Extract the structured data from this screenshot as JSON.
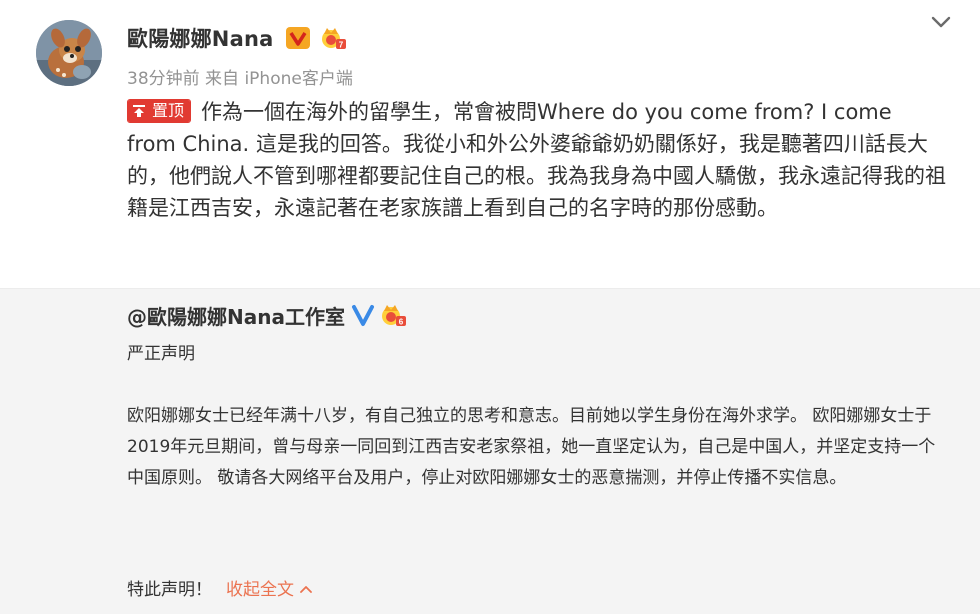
{
  "post": {
    "author": "歐陽娜娜Nana",
    "meta": "38分钟前 来自 iPhone客户端",
    "pin_label": "置顶",
    "text": "作為一個在海外的留學生，常會被問Where do you come from? I come from China. 這是我的回答。我從小和外公外婆爺爺奶奶關係好，我是聽著四川話長大的，他們說人不管到哪裡都要記住自己的根。我為我身為中國人驕傲，我永遠記得我的祖籍是江西吉安，永遠記著在老家族譜上看到自己的名字時的那份感動。"
  },
  "repost": {
    "author": "@歐陽娜娜Nana工作室",
    "heading": "严正声明",
    "body": "欧阳娜娜女士已经年满十八岁，有自己独立的思考和意志。目前她以学生身份在海外求学。 欧阳娜娜女士于2019年元旦期间，曾与母亲一同回到江西吉安老家祭祖，她一直坚定认为，自己是中国人，并坚定支持一个中国原则。 敬请各大网络平台及用户，停止对欧阳娜娜女士的恶意揣测，并停止传播不实信息。",
    "closing": "特此声明！",
    "collapse_label": "收起全文"
  },
  "colors": {
    "pin_red": "#e13a32",
    "link_orange": "#eb7350",
    "repost_bg": "#f4f4f4",
    "verified_orange": "#f5a623",
    "verified_blue": "#3a8ae6"
  },
  "icons": [
    "avatar-fawn-image",
    "orange-verified-v-icon",
    "crown-level-icon",
    "blue-verified-v-icon",
    "chevron-down-icon",
    "pin-icon",
    "chevron-up-icon"
  ]
}
